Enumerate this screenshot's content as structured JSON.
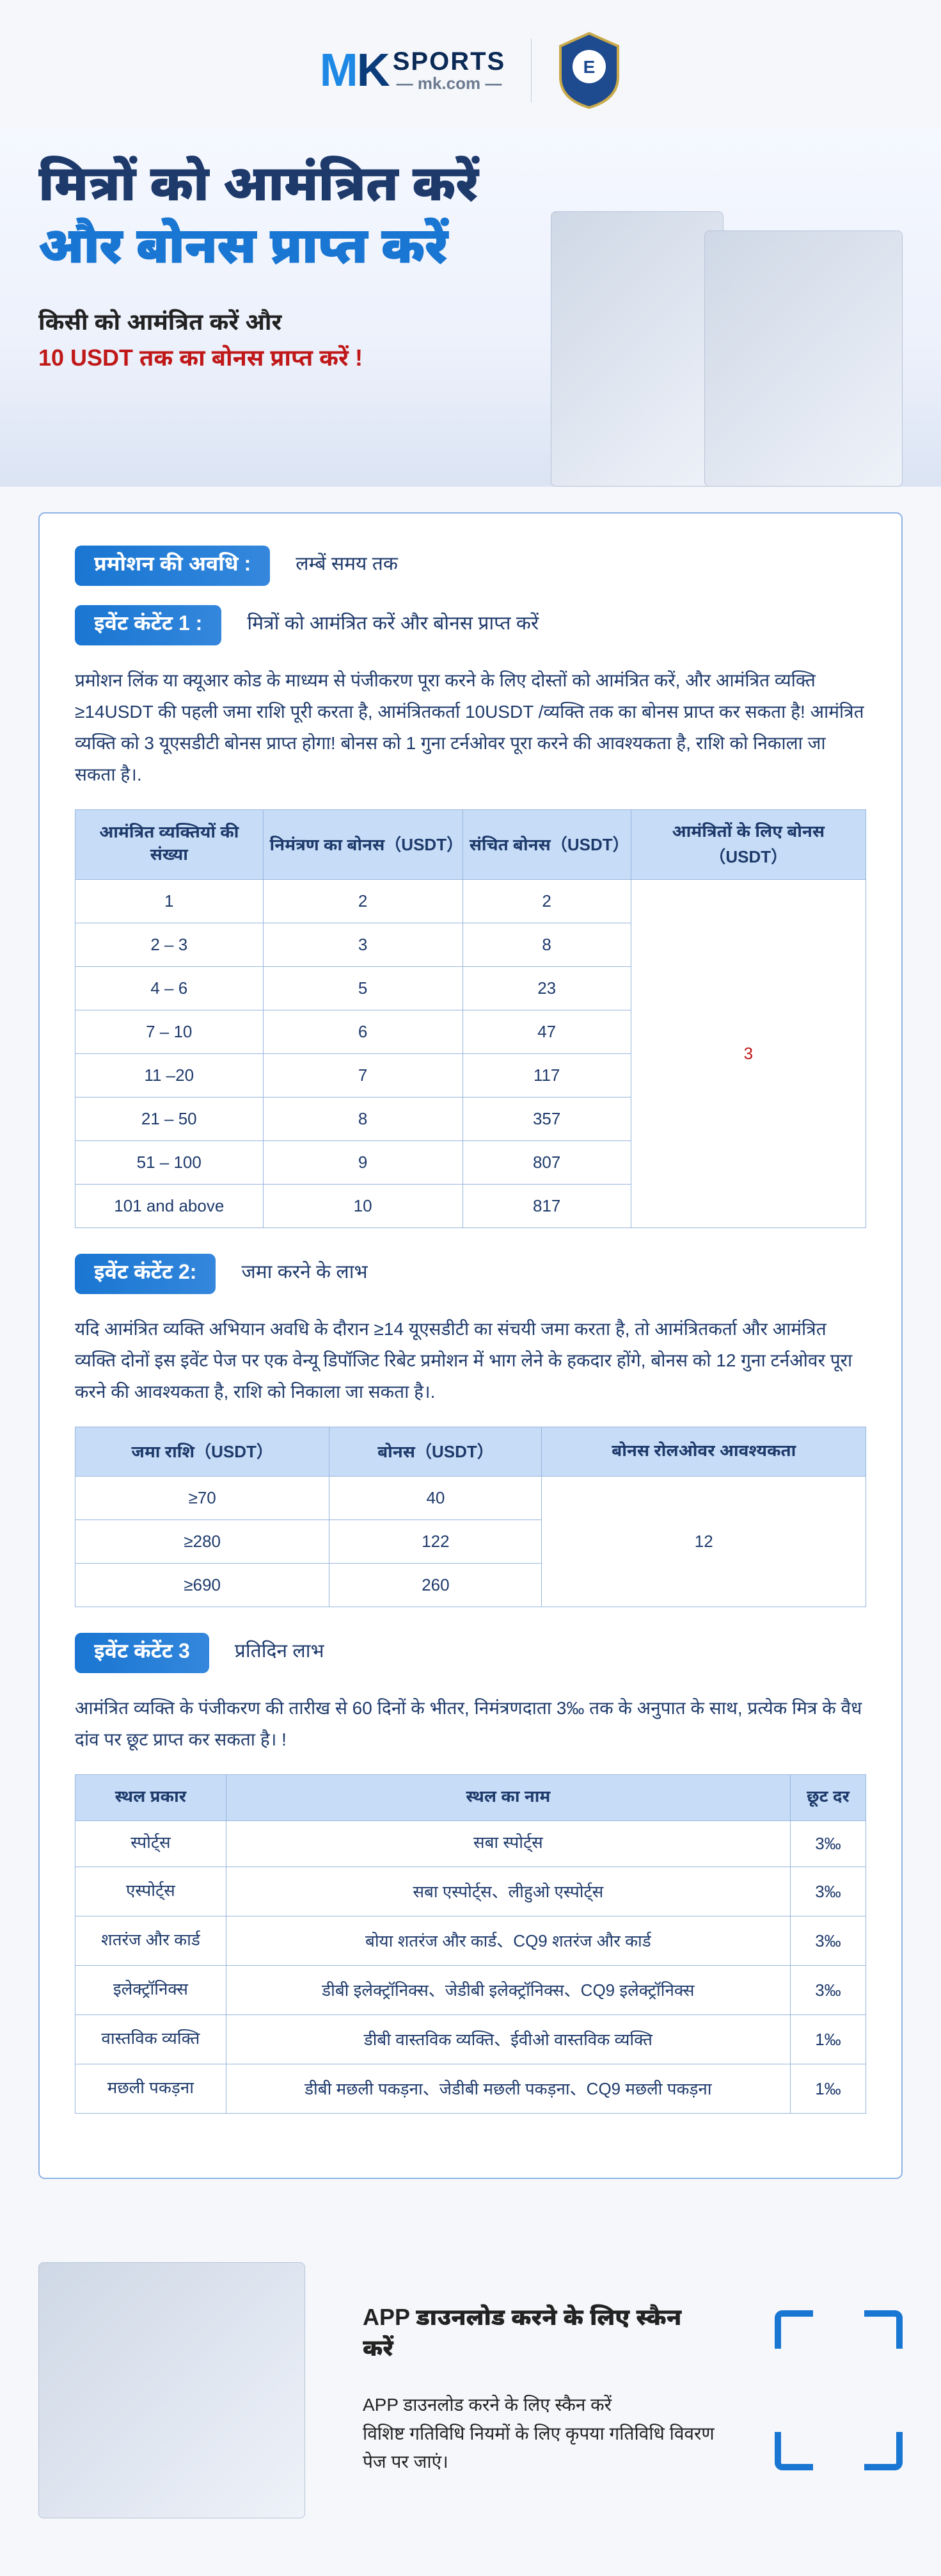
{
  "header": {
    "logo_left": "M",
    "logo_right": "K",
    "logo_word": "SPORTS",
    "logo_domain": "— mk.com —",
    "badge_alt": "Empoli F.C."
  },
  "hero": {
    "line1": "मित्रों को आमंत्रित करें",
    "line2": "और बोनस प्राप्त करें",
    "sub1": "किसी को आमंत्रित करें और",
    "sub2": "10 USDT तक का बोनस प्राप्त करें !"
  },
  "promo_period": {
    "label": "प्रमोशन की अवधि :",
    "value": "लम्बें समय तक"
  },
  "event1": {
    "label": "इवेंट कंटेंट 1 :",
    "title": "मित्रों को आमंत्रित करें और बोनस प्राप्त करें",
    "para": "प्रमोशन लिंक या क्यूआर कोड के माध्यम से पंजीकरण पूरा करने के लिए दोस्तों को आमंत्रित करें, और आमंत्रित व्यक्ति ≥14USDT की पहली जमा राशि पूरी करता है, आमंत्रितकर्ता 10USDT /व्यक्ति तक का बोनस प्राप्त कर सकता है! आमंत्रित व्यक्ति को 3 यूएसडीटी बोनस प्राप्त होगा! बोनस को 1 गुना टर्नओवर पूरा करने की आवश्यकता है, राशि को निकाला जा सकता है।.",
    "headers": [
      "आमंत्रित व्यक्तियों की संख्या",
      "निमंत्रण का बोनस（USDT）",
      "संचित बोनस（USDT）",
      "आमंत्रितों के लिए बोनस（USDT）"
    ],
    "rows": [
      {
        "count": "1",
        "bonus": "2",
        "cum": "2"
      },
      {
        "count": "2 – 3",
        "bonus": "3",
        "cum": "8"
      },
      {
        "count": "4 – 6",
        "bonus": "5",
        "cum": "23"
      },
      {
        "count": "7 – 10",
        "bonus": "6",
        "cum": "47"
      },
      {
        "count": "11 –20",
        "bonus": "7",
        "cum": "117"
      },
      {
        "count": "21 – 50",
        "bonus": "8",
        "cum": "357"
      },
      {
        "count": "51 – 100",
        "bonus": "9",
        "cum": "807"
      },
      {
        "count": "101 and above",
        "bonus": "10",
        "cum": "817"
      }
    ],
    "invitee_bonus": "3"
  },
  "event2": {
    "label": "इवेंट कंटेंट 2:",
    "title": "जमा करने के लाभ",
    "para": "यदि आमंत्रित व्यक्ति अभियान अवधि के दौरान ≥14 यूएसडीटी का संचयी जमा करता है, तो आमंत्रितकर्ता और आमंत्रित व्यक्ति दोनों इस इवेंट पेज पर एक वेन्यू डिपॉजिट रिबेट प्रमोशन में भाग लेने के हकदार होंगे, बोनस को 12 गुना टर्नओवर पूरा करने की आवश्यकता है, राशि को निकाला जा सकता है।.",
    "headers": [
      "जमा राशि（USDT）",
      "बोनस（USDT）",
      "बोनस रोलओवर आवश्यकता"
    ],
    "rows": [
      {
        "dep": "≥70",
        "bonus": "40"
      },
      {
        "dep": "≥280",
        "bonus": "122"
      },
      {
        "dep": "≥690",
        "bonus": "260"
      }
    ],
    "rollover": "12"
  },
  "event3": {
    "label": "इवेंट कंटेंट 3",
    "title": "प्रतिदिन लाभ",
    "para": "आमंत्रित व्यक्ति के पंजीकरण की तारीख से 60 दिनों के भीतर, निमंत्रणदाता 3‰ तक के अनुपात के साथ, प्रत्येक मित्र के वैध दांव पर छूट प्राप्त कर सकता है। !",
    "headers": [
      "स्थल प्रकार",
      "स्थल का नाम",
      "छूट दर"
    ],
    "rows": [
      {
        "type": "स्पोर्ट्स",
        "venue": "सबा स्पोर्ट्स",
        "rate": "3‰"
      },
      {
        "type": "एस्पोर्ट्स",
        "venue": "सबा एस्पोर्ट्स、लीहुओ एस्पोर्ट्स",
        "rate": "3‰"
      },
      {
        "type": "शतरंज और कार्ड",
        "venue": "बोया शतरंज और कार्ड、CQ9 शतरंज और कार्ड",
        "rate": "3‰"
      },
      {
        "type": "इलेक्ट्रॉनिक्स",
        "venue": "डीबी इलेक्ट्रॉनिक्स、जेडीबी इलेक्ट्रॉनिक्स、CQ9 इलेक्ट्रॉनिक्स",
        "rate": "3‰"
      },
      {
        "type": "वास्तविक व्यक्ति",
        "venue": "डीबी वास्तविक व्यक्ति、ईवीओ वास्तविक व्यक्ति",
        "rate": "1‰"
      },
      {
        "type": "मछली पकड़ना",
        "venue": "डीबी मछली पकड़ना、जेडीबी मछली पकड़ना、CQ9 मछली पकड़ना",
        "rate": "1‰"
      }
    ]
  },
  "app": {
    "title": "APP  डाउनलोड करने के लिए स्कैन करें",
    "body1": "APP  डाउनलोड करने के लिए स्कैन करें",
    "body2": "विशिष्ट गतिविधि नियमों के लिए कृपया गतिविधि विवरण पेज पर जाएं।"
  }
}
